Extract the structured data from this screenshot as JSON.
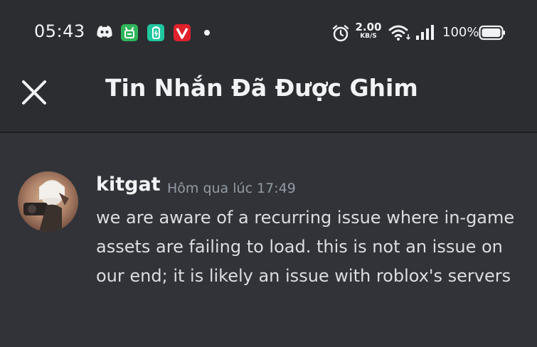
{
  "status_bar": {
    "time": "05:43",
    "network_speed_value": "2.00",
    "network_speed_unit": "KB/S",
    "battery_percent": "100%"
  },
  "header": {
    "title": "Tin Nhắn Đã Được Ghim"
  },
  "pinned_messages": [
    {
      "author": "kitgat",
      "timestamp": "Hôm qua lúc 17:49",
      "content": "we are aware of a recurring issue where in-game assets are failing to load. this is not an issue on our end; it is likely an issue with roblox's servers"
    }
  ],
  "colors": {
    "background": "#313338",
    "header_background": "#2b2d31",
    "text_primary": "#f2f3f5",
    "text_message": "#dbdee1",
    "text_muted": "#949ba4"
  }
}
